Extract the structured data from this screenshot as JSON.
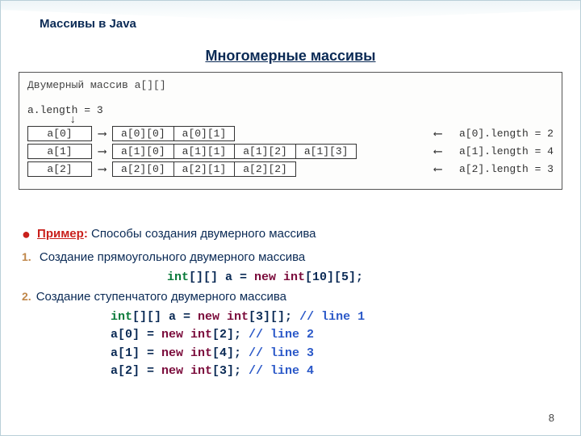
{
  "slide_title": "Массивы в Java",
  "section_title": "Многомерные массивы",
  "page_number": "8",
  "diagram": {
    "title": "Двумерный массив a[][]",
    "length_line": "a.length = 3",
    "rows": [
      {
        "head": "a[0]",
        "cells": [
          "a[0][0]",
          "a[0][1]"
        ],
        "right": "a[0].length = 2"
      },
      {
        "head": "a[1]",
        "cells": [
          "a[1][0]",
          "a[1][1]",
          "a[1][2]",
          "a[1][3]"
        ],
        "right": "a[1].length = 4"
      },
      {
        "head": "a[2]",
        "cells": [
          "a[2][0]",
          "a[2][1]",
          "a[2][2]"
        ],
        "right": "a[2].length = 3"
      }
    ]
  },
  "example": {
    "label": "Пример",
    "colon": ": ",
    "text": "Способы создания двумерного массива",
    "items": [
      {
        "num": "1.",
        "text": " Создание прямоугольного двумерного массива",
        "code_lines": [
          {
            "indent_class": "code-line-1",
            "tokens": [
              {
                "t": "int",
                "c": "c-type"
              },
              {
                "t": "[][] a = "
              },
              {
                "t": "new int",
                "c": "c-kw"
              },
              {
                "t": "[10][5];"
              }
            ]
          }
        ]
      },
      {
        "num": "2.",
        "text": "Создание ступенчатого двумерного массива",
        "code_lines": [
          {
            "indent_class": "code-block-2",
            "tokens": [
              {
                "t": "int",
                "c": "c-type"
              },
              {
                "t": "[][] a = "
              },
              {
                "t": "new int",
                "c": "c-kw"
              },
              {
                "t": "[3][]; "
              },
              {
                "t": "// line 1",
                "c": "c-comment"
              }
            ]
          },
          {
            "indent_class": "code-block-2",
            "tokens": [
              {
                "t": "a[0] = "
              },
              {
                "t": "new int",
                "c": "c-kw"
              },
              {
                "t": "[2]; "
              },
              {
                "t": "// line 2",
                "c": "c-comment"
              }
            ]
          },
          {
            "indent_class": "code-block-2",
            "tokens": [
              {
                "t": "a[1] = "
              },
              {
                "t": "new int",
                "c": "c-kw"
              },
              {
                "t": "[4]; "
              },
              {
                "t": "// line 3",
                "c": "c-comment"
              }
            ]
          },
          {
            "indent_class": "code-block-2",
            "tokens": [
              {
                "t": "a[2] = "
              },
              {
                "t": "new int",
                "c": "c-kw"
              },
              {
                "t": "[3]; "
              },
              {
                "t": "// line 4",
                "c": "c-comment"
              }
            ]
          }
        ]
      }
    ]
  }
}
